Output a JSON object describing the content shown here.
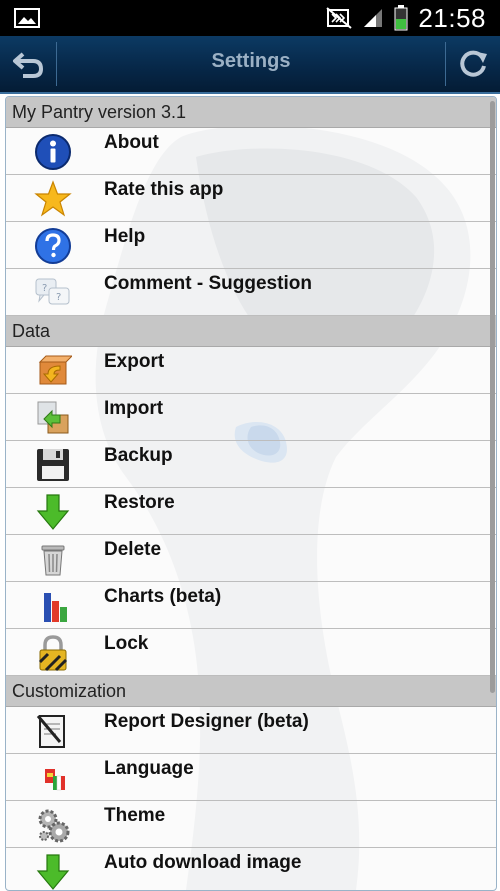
{
  "status_bar": {
    "time": "21:58"
  },
  "action_bar": {
    "title": "Settings"
  },
  "sections": [
    {
      "header": "My Pantry version 3.1",
      "items": [
        {
          "label": "About",
          "icon": "info-icon"
        },
        {
          "label": "Rate this app",
          "icon": "star-icon"
        },
        {
          "label": "Help",
          "icon": "question-icon"
        },
        {
          "label": "Comment - Suggestion",
          "icon": "speech-bubbles-icon"
        }
      ]
    },
    {
      "header": "Data",
      "items": [
        {
          "label": "Export",
          "icon": "export-box-icon"
        },
        {
          "label": "Import",
          "icon": "import-icon"
        },
        {
          "label": "Backup",
          "icon": "floppy-disk-icon"
        },
        {
          "label": "Restore",
          "icon": "down-arrow-icon"
        },
        {
          "label": "Delete",
          "icon": "trash-can-icon"
        },
        {
          "label": "Charts (beta)",
          "icon": "bar-chart-icon"
        },
        {
          "label": "Lock",
          "icon": "padlock-icon"
        }
      ]
    },
    {
      "header": "Customization",
      "items": [
        {
          "label": "Report Designer (beta)",
          "icon": "report-pen-icon"
        },
        {
          "label": "Language",
          "icon": "flags-icon"
        },
        {
          "label": "Theme",
          "icon": "gears-icon"
        },
        {
          "label": "Auto download image",
          "icon": "down-arrow-icon"
        }
      ]
    }
  ]
}
